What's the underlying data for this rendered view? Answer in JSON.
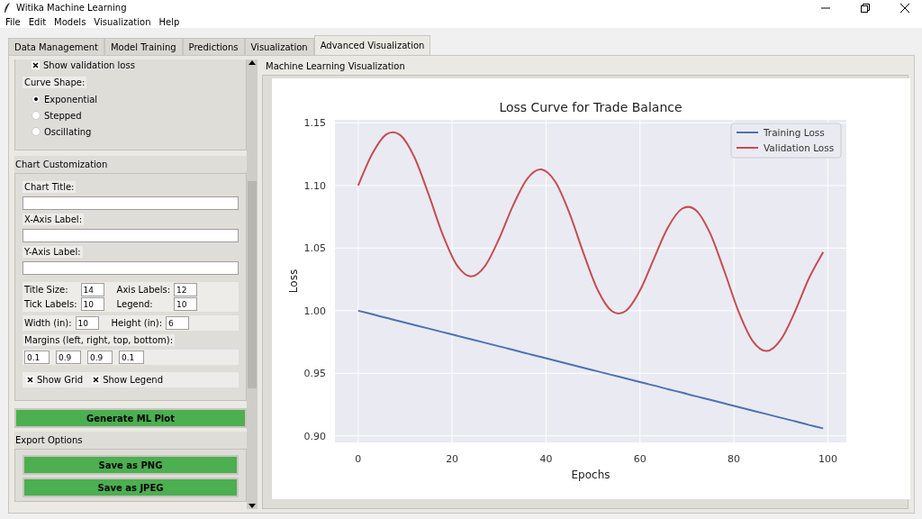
{
  "window": {
    "title": "Witika Machine Learning"
  },
  "menu": [
    "File",
    "Edit",
    "Models",
    "Visualization",
    "Help"
  ],
  "tabs": [
    {
      "label": "Data Management",
      "selected": false
    },
    {
      "label": "Model Training",
      "selected": false
    },
    {
      "label": "Predictions",
      "selected": false
    },
    {
      "label": "Visualization",
      "selected": false
    },
    {
      "label": "Advanced Visualization",
      "selected": true
    }
  ],
  "left_panel": {
    "show_validation_loss": {
      "label": "Show validation loss",
      "checked": true
    },
    "curve_shape": {
      "label": "Curve Shape:",
      "options": [
        {
          "label": "Exponential",
          "selected": true
        },
        {
          "label": "Stepped",
          "selected": false
        },
        {
          "label": "Oscillating",
          "selected": false
        }
      ]
    },
    "chart_customization": {
      "title": "Chart Customization",
      "text_fields": [
        {
          "label": "Chart Title:"
        },
        {
          "label": "X-Axis Label:"
        },
        {
          "label": "Y-Axis Label:"
        }
      ],
      "font_sizes": [
        {
          "label": "Title Size:",
          "value": "14"
        },
        {
          "label": "Axis Labels:",
          "value": "12"
        },
        {
          "label": "Tick Labels:",
          "value": "10"
        },
        {
          "label": "Legend:",
          "value": "10"
        }
      ],
      "figure_size": [
        {
          "label": "Width (in):",
          "value": "10"
        },
        {
          "label": "Height (in):",
          "value": "6"
        }
      ],
      "margins_label": "Margins (left, right, top, bottom):",
      "margins": [
        "0.1",
        "0.9",
        "0.9",
        "0.1"
      ],
      "options": [
        {
          "label": "Show Grid",
          "checked": true
        },
        {
          "label": "Show Legend",
          "checked": true
        }
      ]
    },
    "generate_button": "Generate ML Plot",
    "export": {
      "title": "Export Options",
      "buttons": [
        "Save as PNG",
        "Save as JPEG"
      ]
    }
  },
  "plot_panel": {
    "title": "Machine Learning Visualization",
    "chart_data": {
      "type": "line",
      "title": "Loss Curve for Trade Balance",
      "xlabel": "Epochs",
      "ylabel": "Loss",
      "x": [
        0,
        3,
        6,
        9,
        12,
        15,
        18,
        21,
        24,
        27,
        30,
        33,
        36,
        39,
        42,
        45,
        48,
        51,
        54,
        57,
        60,
        63,
        66,
        69,
        72,
        75,
        78,
        81,
        84,
        87,
        90,
        93,
        96,
        99
      ],
      "series": [
        {
          "name": "Training Loss",
          "color": "#4c72b0",
          "values": [
            1.0,
            0.9972,
            0.9943,
            0.9915,
            0.9886,
            0.9858,
            0.9829,
            0.9801,
            0.9772,
            0.9744,
            0.9715,
            0.9687,
            0.9658,
            0.963,
            0.9601,
            0.9573,
            0.9544,
            0.9516,
            0.9487,
            0.9459,
            0.943,
            0.9402,
            0.9373,
            0.9345,
            0.9316,
            0.9288,
            0.9259,
            0.9231,
            0.9202,
            0.9174,
            0.9145,
            0.9117,
            0.9088,
            0.906
          ]
        },
        {
          "name": "Validation Loss",
          "color": "#c44e52",
          "values": [
            1.1,
            1.1254,
            1.1409,
            1.1402,
            1.1224,
            1.0928,
            1.0608,
            1.0365,
            1.0274,
            1.0357,
            1.0575,
            1.0842,
            1.1055,
            1.1129,
            1.1028,
            1.0779,
            1.0457,
            1.0166,
            0.9997,
            0.9999,
            1.0162,
            1.0418,
            1.0669,
            1.0816,
            1.08,
            1.0613,
            1.0312,
            0.9993,
            0.9759,
            0.9678,
            0.9769,
            0.9993,
            1.026,
            1.0468
          ]
        }
      ],
      "grid": true,
      "legend": true,
      "xlim": [
        -4.95,
        103.95
      ],
      "ylim": [
        0.8948,
        1.1525
      ],
      "xticks": [
        0,
        20,
        40,
        60,
        80,
        100
      ],
      "yticks": [
        {
          "value": 0.9,
          "label": "0.90"
        },
        {
          "value": 0.95,
          "label": "0.95"
        },
        {
          "value": 1.0,
          "label": "1.00"
        },
        {
          "value": 1.05,
          "label": "1.05"
        },
        {
          "value": 1.1,
          "label": "1.10"
        },
        {
          "value": 1.15,
          "label": "1.15"
        }
      ]
    }
  }
}
